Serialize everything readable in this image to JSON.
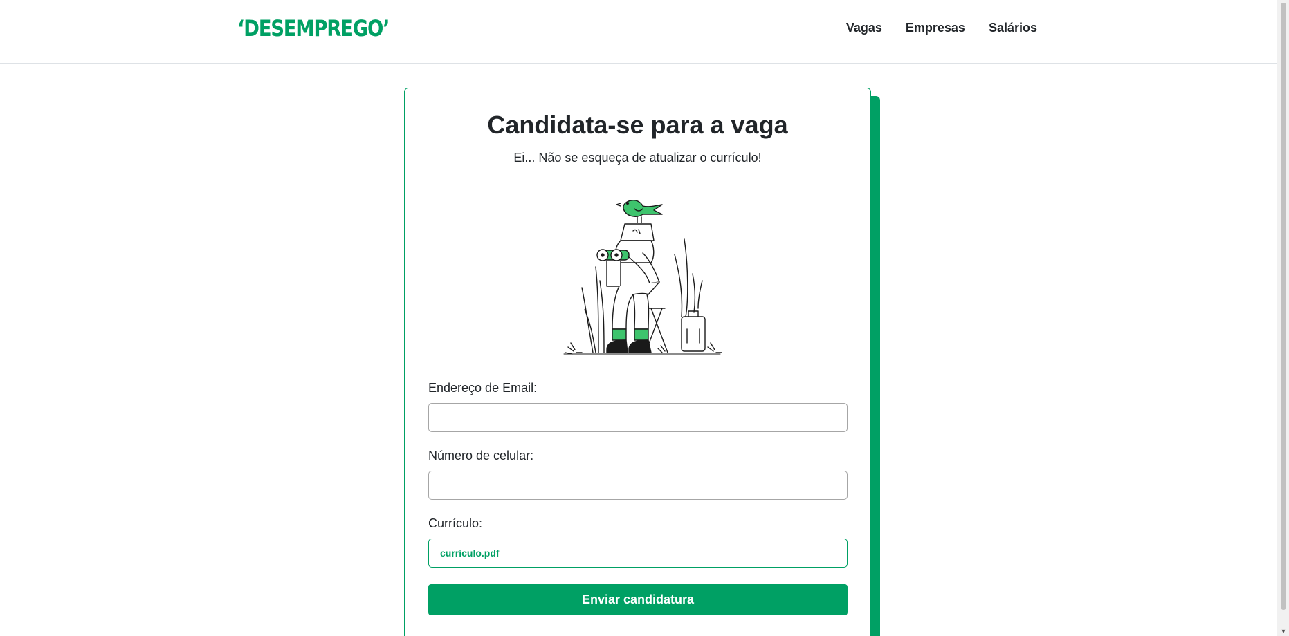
{
  "brand": {
    "logo": "‘DESEMPREGO’",
    "accent": "#00a064"
  },
  "nav": {
    "items": [
      "Vagas",
      "Empresas",
      "Salários"
    ]
  },
  "form": {
    "title": "Candidata-se para a vaga",
    "subtitle": "Ei... Não se esqueça de atualizar o currículo!",
    "illustration": "person-with-binoculars-and-bird-illustration",
    "email": {
      "label": "Endereço de Email:",
      "value": "",
      "placeholder": ""
    },
    "phone": {
      "label": "Número de celular:",
      "value": "",
      "placeholder": ""
    },
    "resume": {
      "label": "Currículo:",
      "file_name": "currículo.pdf"
    },
    "submit_label": "Enviar candidatura"
  }
}
